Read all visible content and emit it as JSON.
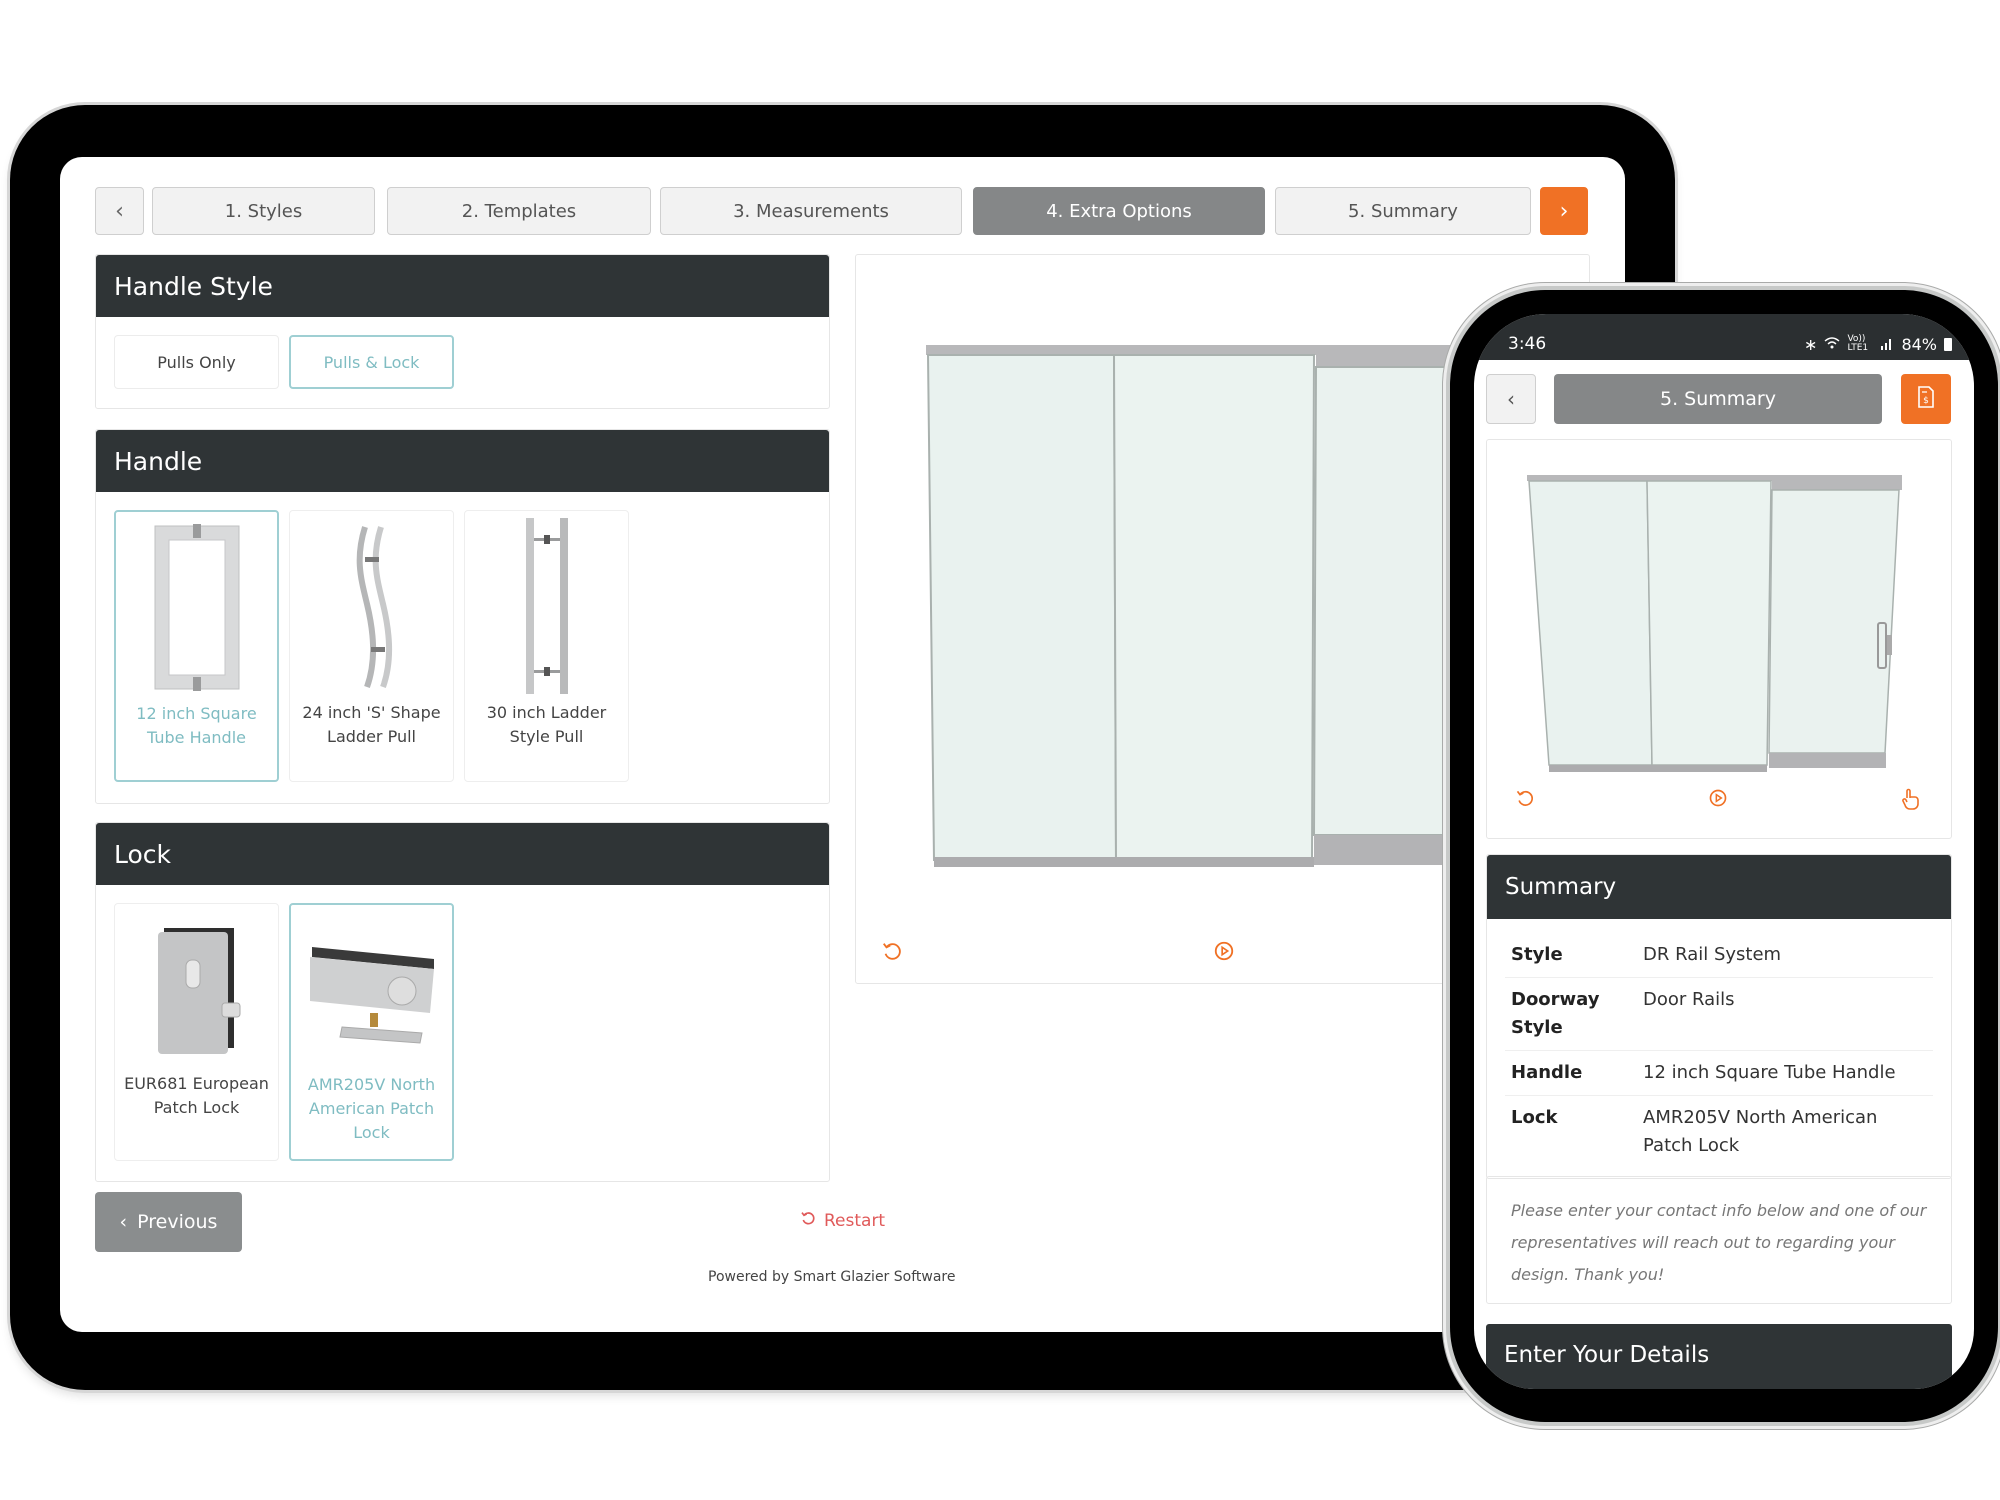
{
  "tablet": {
    "steps": {
      "prev_icon": "chevron-left-icon",
      "next_icon": "chevron-right-icon",
      "items": [
        {
          "label": "1. Styles",
          "active": false
        },
        {
          "label": "2. Templates",
          "active": false
        },
        {
          "label": "3. Measurements",
          "active": false
        },
        {
          "label": "4. Extra Options",
          "active": true
        },
        {
          "label": "5. Summary",
          "active": false
        }
      ]
    },
    "handle_style": {
      "title": "Handle Style",
      "options": [
        {
          "label": "Pulls Only",
          "selected": false
        },
        {
          "label": "Pulls & Lock",
          "selected": true
        }
      ]
    },
    "handle": {
      "title": "Handle",
      "options": [
        {
          "label": "12 inch Square Tube Handle",
          "selected": true
        },
        {
          "label": "24 inch 'S' Shape Ladder Pull",
          "selected": false
        },
        {
          "label": "30 inch Ladder Style Pull",
          "selected": false
        }
      ]
    },
    "lock": {
      "title": "Lock",
      "options": [
        {
          "label": "EUR681 European Patch Lock",
          "selected": false
        },
        {
          "label": "AMR205V North American Patch Lock",
          "selected": true
        }
      ]
    },
    "footer": {
      "previous_label": "Previous",
      "restart_label": "Restart",
      "powered_by": "Powered by Smart Glazier Software"
    },
    "preview": {
      "controls": [
        "rotate-icon",
        "play-icon"
      ]
    }
  },
  "phone": {
    "status_bar": {
      "time": "3:46",
      "network": "Vo)) LTE1",
      "battery": "84%"
    },
    "nav": {
      "title": "5. Summary",
      "quote_icon": "invoice-dollar-icon"
    },
    "preview": {
      "controls": [
        "rotate-icon",
        "play-icon",
        "hand-pointer-icon"
      ]
    },
    "summary": {
      "title": "Summary",
      "rows": [
        {
          "key": "Style",
          "value": "DR Rail System"
        },
        {
          "key": "Doorway Style",
          "value": "Door Rails"
        },
        {
          "key": "Handle",
          "value": "12 inch Square Tube Handle"
        },
        {
          "key": "Lock",
          "value": "AMR205V North American Patch Lock"
        }
      ]
    },
    "contact_note": "Please enter your contact info below and one of our representatives will reach out to regarding your design. Thank you!",
    "details_title": "Enter Your Details"
  },
  "colors": {
    "accent_orange": "#f07125",
    "header_dark": "#2f3436",
    "selected_teal": "#7fbcc2",
    "active_step_gray": "#858788",
    "restart_red": "#e05a5a"
  }
}
